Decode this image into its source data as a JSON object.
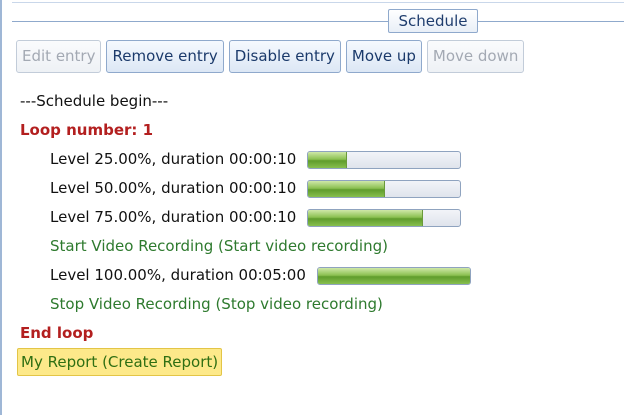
{
  "group": {
    "caption": "Schedule"
  },
  "toolbar": {
    "buttons": [
      {
        "label": "Edit entry",
        "enabled": false
      },
      {
        "label": "Remove entry",
        "enabled": true
      },
      {
        "label": "Disable entry",
        "enabled": true
      },
      {
        "label": "Move up",
        "enabled": true
      },
      {
        "label": "Move down",
        "enabled": false
      }
    ]
  },
  "schedule": {
    "begin": "---Schedule begin---",
    "loop_label": "Loop number: 1",
    "entries": [
      {
        "text": "Level 25.00%, duration 00:00:10",
        "level": 0.25
      },
      {
        "text": "Level 50.00%, duration 00:00:10",
        "level": 0.5
      },
      {
        "text": "Level 75.00%, duration 00:00:10",
        "level": 0.75
      },
      {
        "text": "Start Video Recording (Start video recording)"
      },
      {
        "text": "Level 100.00%, duration 00:05:00",
        "level": 1.0
      },
      {
        "text": "Stop Video Recording (Stop video recording)"
      }
    ],
    "end_loop": "End loop",
    "report": "My Report (Create Report)"
  },
  "colors": {
    "loop_text": "#b31f1f",
    "video_text": "#2e7a2e",
    "report_bg": "#fde98a",
    "bar_fill": "#8cc152"
  }
}
